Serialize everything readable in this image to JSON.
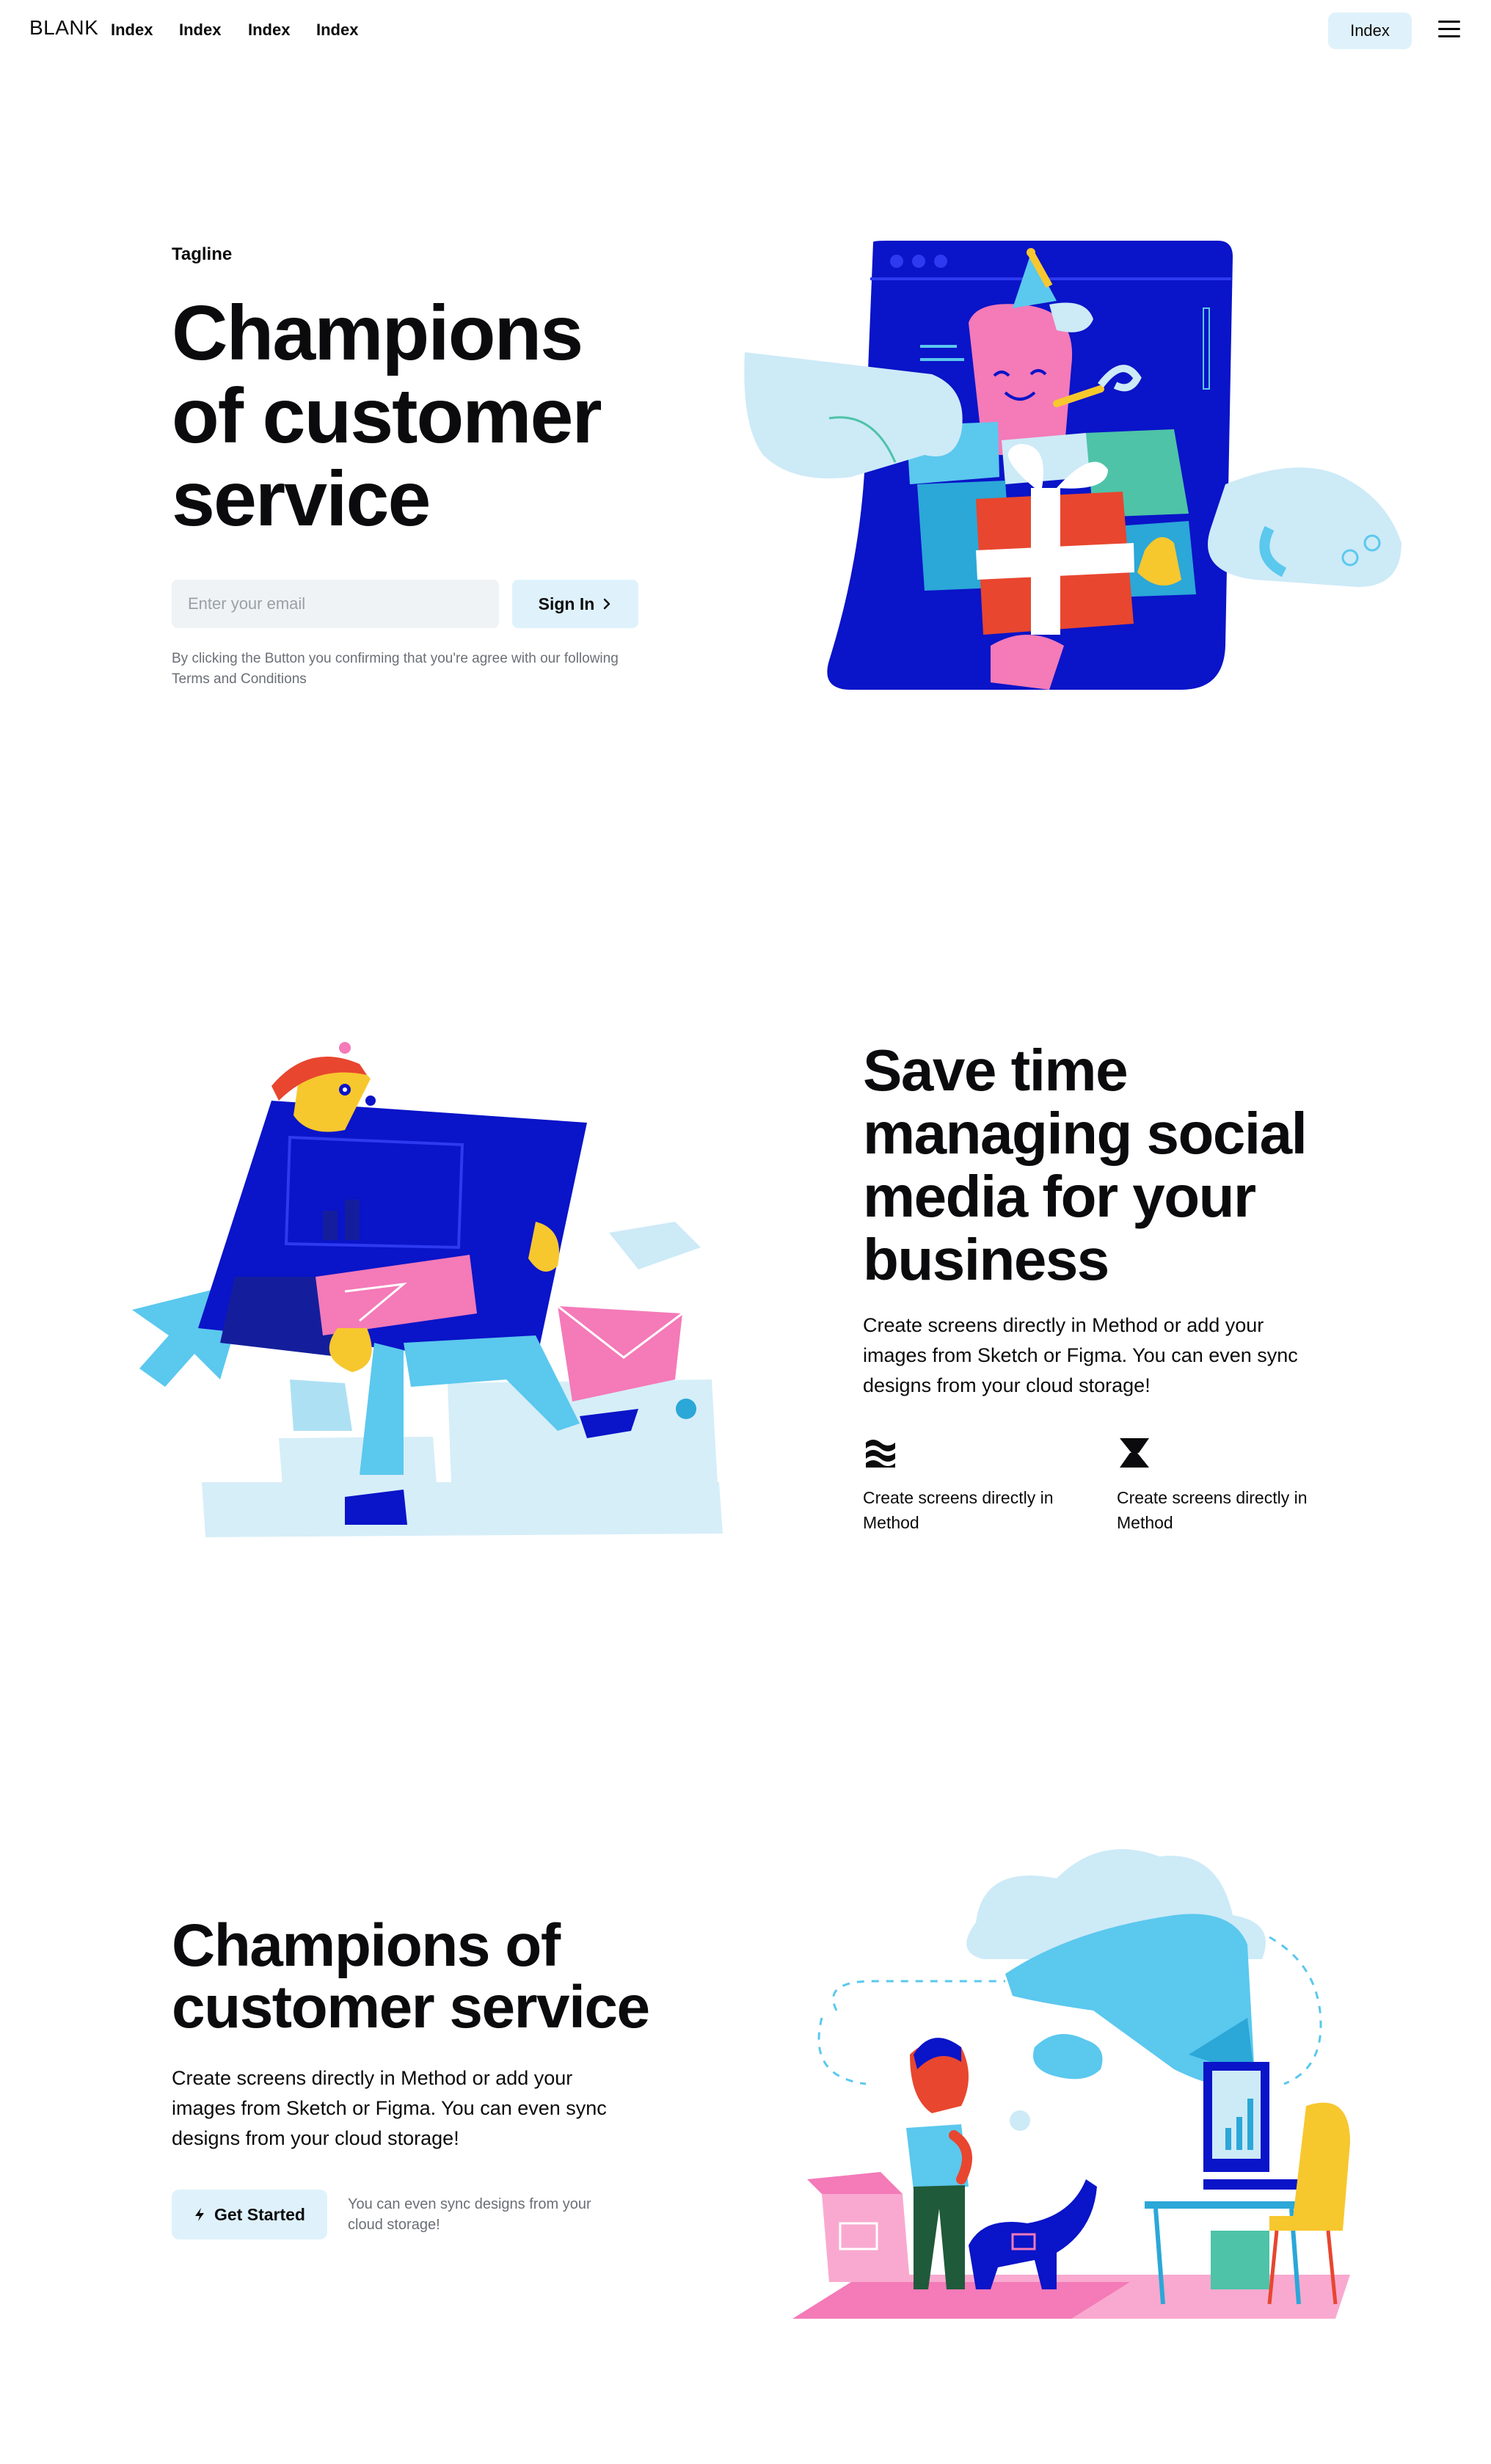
{
  "nav": {
    "brand": "BLANK",
    "links": [
      "Index",
      "Index",
      "Index",
      "Index"
    ],
    "cta": "Index",
    "menu_icon": "hamburger-icon"
  },
  "hero": {
    "tagline": "Tagline",
    "title": "Champions of customer service",
    "email_placeholder": "Enter your email",
    "signin_label": "Sign In",
    "signin_icon": "chevron-right-icon",
    "legal": "By clicking the Button you confirming that you're agree with our following Terms and Conditions"
  },
  "section2": {
    "title": "Save time managing social media for your business",
    "body": "Create screens directly in Method or add your images from Sketch or Figma. You can even sync designs from your cloud storage!",
    "features": [
      {
        "icon": "layers-wave-icon",
        "text": "Create screens directly in Method"
      },
      {
        "icon": "bolt-z-icon",
        "text": "Create screens directly in Method"
      }
    ]
  },
  "section3": {
    "title": "Champions of customer service",
    "body": "Create screens directly in Method or add your images from Sketch or Figma. You can even sync designs from your cloud storage!",
    "button_label": "Get Started",
    "button_icon": "lightning-icon",
    "note": "You can even sync designs from your cloud storage!"
  },
  "colors": {
    "accent_light": "#dff2fb",
    "navy": "#0a14c8",
    "sky": "#5bc8ee",
    "pink": "#f47ab8",
    "yellow": "#f7c72e",
    "red": "#e8462f"
  }
}
